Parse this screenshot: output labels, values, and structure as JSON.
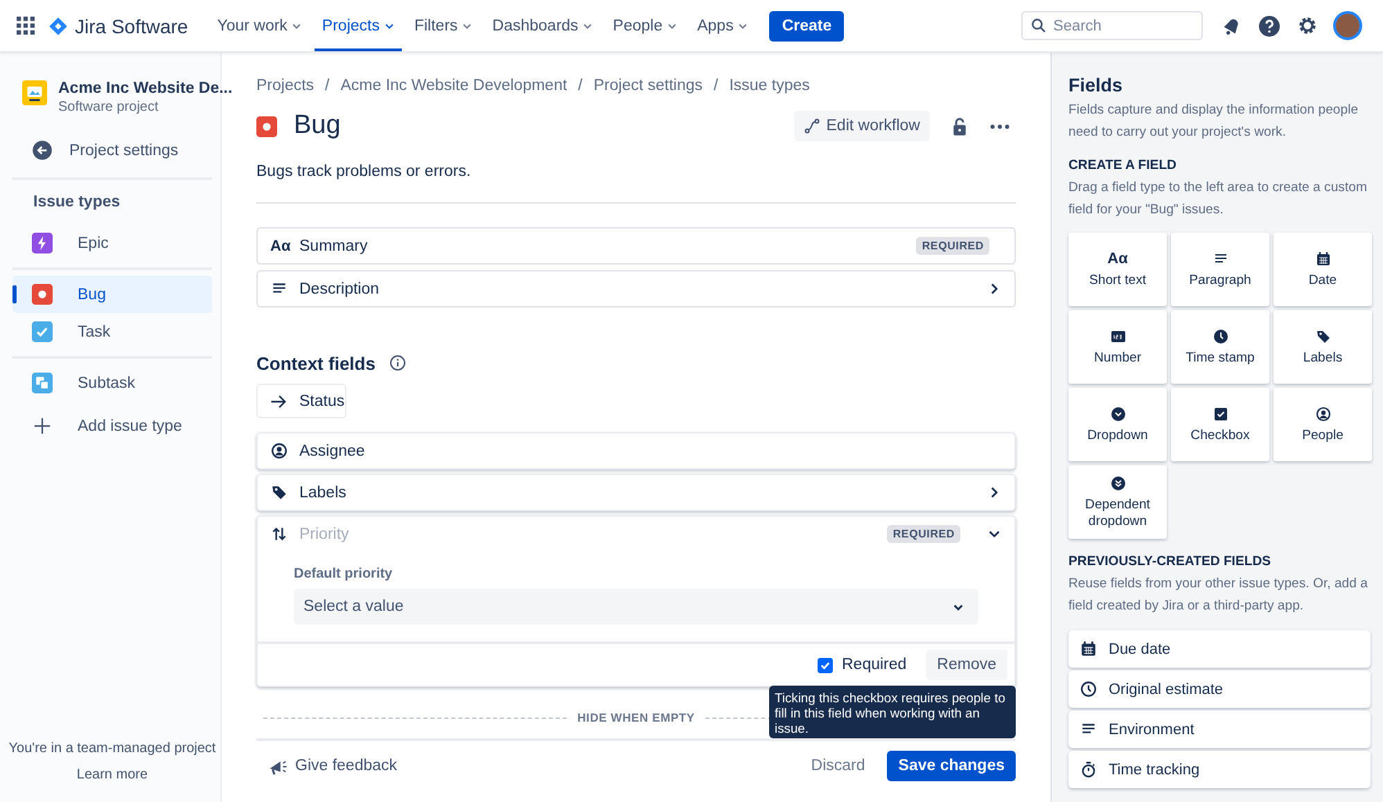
{
  "nav": {
    "product": "Jira Software",
    "items": [
      {
        "label": "Your work",
        "selected": false
      },
      {
        "label": "Projects",
        "selected": true
      },
      {
        "label": "Filters",
        "selected": false
      },
      {
        "label": "Dashboards",
        "selected": false
      },
      {
        "label": "People",
        "selected": false
      },
      {
        "label": "Apps",
        "selected": false
      }
    ],
    "create": "Create",
    "search": {
      "placeholder": "Search"
    }
  },
  "sidebar": {
    "project": {
      "name": "Acme Inc Website De...",
      "type": "Software project"
    },
    "back": "Project settings",
    "section": "Issue types",
    "groups": [
      [
        {
          "label": "Epic",
          "kind": "epic",
          "selected": false
        }
      ],
      [
        {
          "label": "Bug",
          "kind": "bug",
          "selected": true
        },
        {
          "label": "Task",
          "kind": "task",
          "selected": false
        }
      ],
      [
        {
          "label": "Subtask",
          "kind": "subtask",
          "selected": false
        }
      ]
    ],
    "add": "Add issue type",
    "footer": {
      "note": "You're in a team-managed project",
      "link": "Learn more"
    }
  },
  "main": {
    "breadcrumbs": [
      {
        "label": "Projects"
      },
      {
        "separator": "/",
        "label": "Acme Inc Website Development"
      },
      {
        "separator": "/",
        "label": "Project settings"
      },
      {
        "separator": "/",
        "label": "Issue types"
      }
    ],
    "title": "Bug",
    "kind": "bug",
    "edit_workflow": "Edit workflow",
    "description": "Bugs track problems or errors.",
    "description_fields": [
      {
        "label": "Summary",
        "glyph": "Aα",
        "badge": "REQUIRED",
        "expandable": false,
        "expanded": false
      },
      {
        "label": "Description",
        "kind": "paragraph",
        "expandable": true,
        "expanded": false
      }
    ],
    "context_heading": "Context fields",
    "status": "Status",
    "context_fields": [
      {
        "label": "Assignee",
        "kind": "person",
        "expandable": false,
        "expanded": false
      },
      {
        "label": "Labels",
        "kind": "label",
        "expandable": true,
        "expanded": false
      },
      {
        "label": "Priority",
        "kind": "priority",
        "badge": "REQUIRED",
        "expandable": true,
        "expanded": true,
        "default_label": "Default priority",
        "select_placeholder": "Select a value",
        "required": {
          "label": "Required",
          "checked": true
        },
        "remove": "Remove",
        "tooltip": "Ticking this checkbox requires people to fill in this field when working with an issue."
      }
    ],
    "hide_when_empty": "HIDE WHEN EMPTY",
    "footer": {
      "feedback": "Give feedback",
      "discard": "Discard",
      "save": "Save changes"
    }
  },
  "panel": {
    "title": "Fields",
    "description": "Fields capture and display the information people need to carry out your project's work.",
    "create_heading": "CREATE A FIELD",
    "create_description": "Drag a field type to the left area to create a custom field for your \"Bug\" issues.",
    "field_types": [
      {
        "label": "Short text",
        "glyph": "Aα"
      },
      {
        "label": "Paragraph",
        "kind": "paragraph"
      },
      {
        "label": "Date",
        "kind": "calendar"
      },
      {
        "label": "Number",
        "kind": "number"
      },
      {
        "label": "Time stamp",
        "kind": "clock"
      },
      {
        "label": "Labels",
        "kind": "label"
      },
      {
        "label": "Dropdown",
        "kind": "dropdown"
      },
      {
        "label": "Checkbox",
        "kind": "checkbox"
      },
      {
        "label": "People",
        "kind": "person"
      },
      {
        "label": "Dependent dropdown",
        "kind": "dependent"
      }
    ],
    "previous_heading": "PREVIOUSLY-CREATED FIELDS",
    "previous_description": "Reuse fields from your other issue types. Or, add a field created by Jira or a third-party app.",
    "previous_fields": [
      {
        "label": "Due date",
        "kind": "calendar"
      },
      {
        "label": "Original estimate",
        "kind": "clock-outline"
      },
      {
        "label": "Environment",
        "kind": "paragraph"
      },
      {
        "label": "Time tracking",
        "kind": "stopwatch"
      }
    ]
  }
}
